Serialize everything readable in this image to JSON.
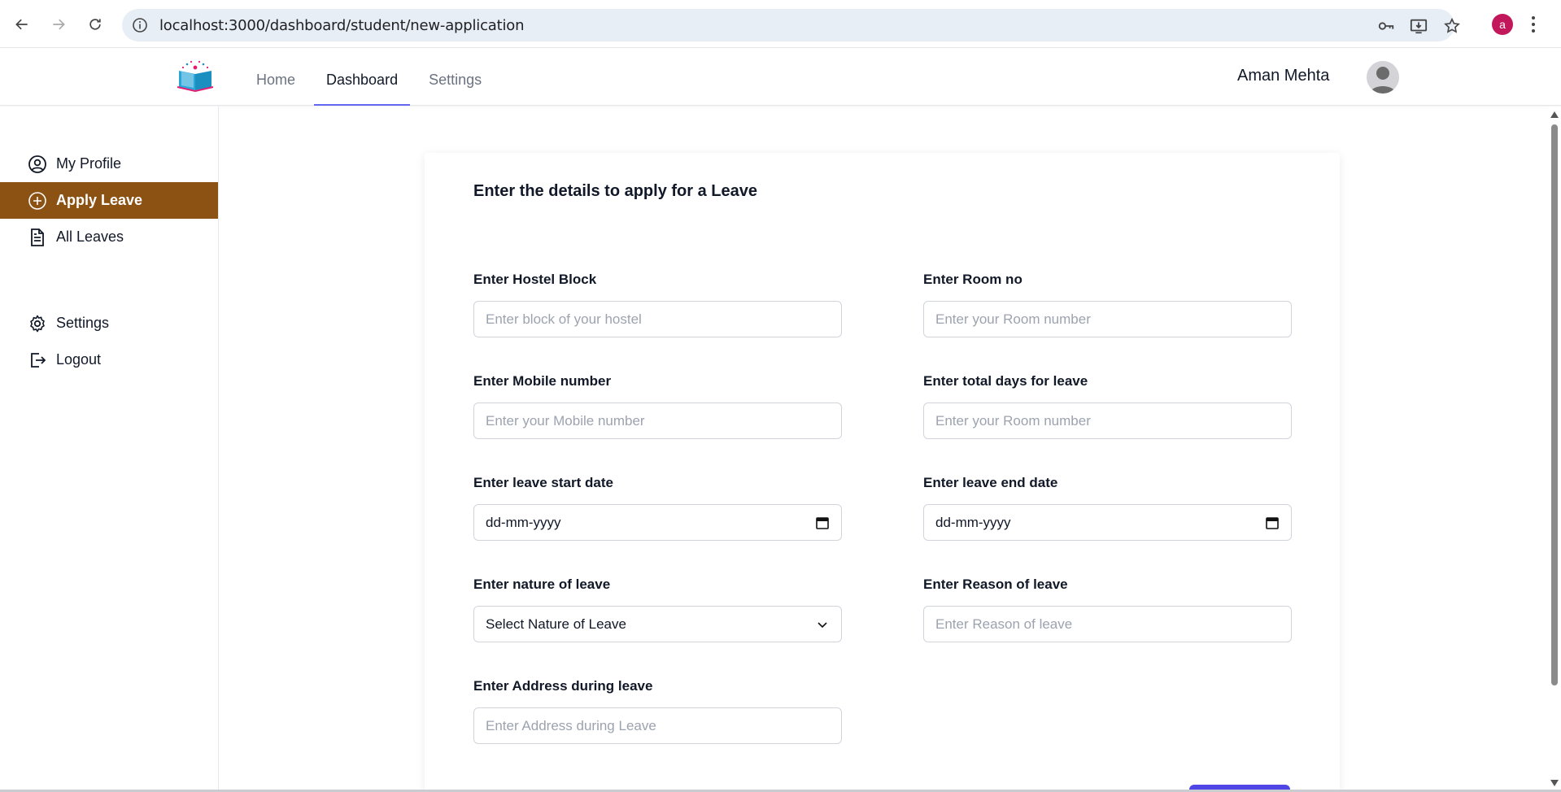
{
  "browser": {
    "url": "localhost:3000/dashboard/student/new-application",
    "profile_initial": "a"
  },
  "header": {
    "nav": [
      {
        "label": "Home",
        "active": false
      },
      {
        "label": "Dashboard",
        "active": true
      },
      {
        "label": "Settings",
        "active": false
      }
    ],
    "user_name": "Aman Mehta"
  },
  "sidebar": {
    "items": [
      {
        "label": "My Profile",
        "icon": "user-circle-icon"
      },
      {
        "label": "Apply Leave",
        "icon": "plus-circle-icon",
        "active": true
      },
      {
        "label": "All Leaves",
        "icon": "document-icon"
      },
      {
        "label": "Settings",
        "icon": "gear-icon"
      },
      {
        "label": "Logout",
        "icon": "logout-icon"
      }
    ]
  },
  "form": {
    "title": "Enter the details to apply for a Leave",
    "hostel_block": {
      "label": "Enter Hostel Block",
      "placeholder": "Enter block of your hostel"
    },
    "room_no": {
      "label": "Enter Room no",
      "placeholder": "Enter your Room number"
    },
    "mobile": {
      "label": "Enter Mobile number",
      "placeholder": "Enter your Mobile number"
    },
    "total_days": {
      "label": "Enter total days for leave",
      "placeholder": "Enter your Room number"
    },
    "start_date": {
      "label": "Enter leave start date",
      "value": "dd-mm-yyyy"
    },
    "end_date": {
      "label": "Enter leave end date",
      "value": "dd-mm-yyyy"
    },
    "nature": {
      "label": "Enter nature of leave",
      "value": "Select Nature of Leave"
    },
    "reason": {
      "label": "Enter Reason of leave",
      "placeholder": "Enter Reason of leave"
    },
    "address": {
      "label": "Enter Address during leave",
      "placeholder": "Enter Address during Leave"
    }
  },
  "colors": {
    "sidebar_active": "#8b5213",
    "nav_active_underline": "#6366f1",
    "submit_button": "#4f46e5"
  }
}
